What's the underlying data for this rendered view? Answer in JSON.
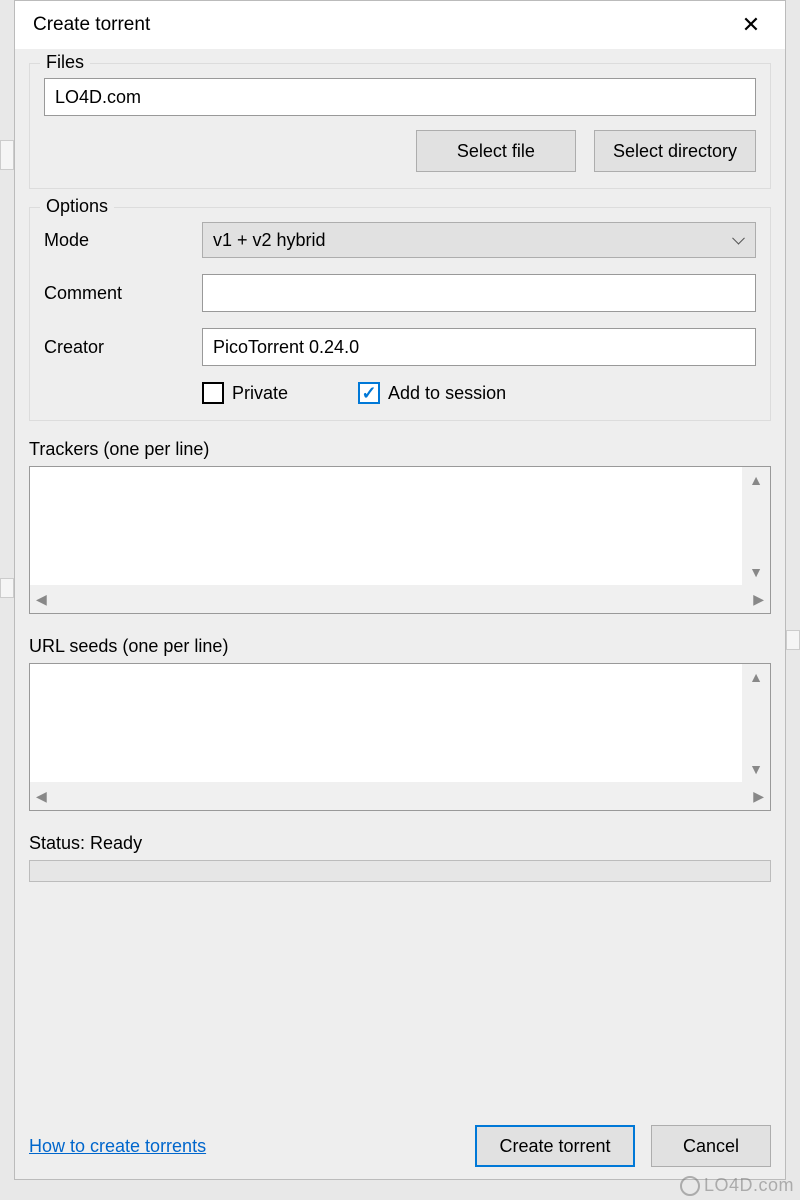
{
  "dialog": {
    "title": "Create torrent",
    "close_label": "✕"
  },
  "files": {
    "legend": "Files",
    "path_value": "LO4D.com",
    "select_file_label": "Select file",
    "select_directory_label": "Select directory"
  },
  "options": {
    "legend": "Options",
    "mode_label": "Mode",
    "mode_value": "v1 + v2 hybrid",
    "comment_label": "Comment",
    "comment_value": "",
    "creator_label": "Creator",
    "creator_value": "PicoTorrent 0.24.0",
    "private_label": "Private",
    "private_checked": false,
    "add_session_label": "Add to session",
    "add_session_checked": true
  },
  "trackers": {
    "label": "Trackers (one per line)",
    "value": ""
  },
  "urlseeds": {
    "label": "URL seeds (one per line)",
    "value": ""
  },
  "status": {
    "label": "Status: Ready",
    "progress": 0
  },
  "footer": {
    "help_link": "How to create torrents",
    "create_label": "Create torrent",
    "cancel_label": "Cancel"
  },
  "watermark": "LO4D.com"
}
